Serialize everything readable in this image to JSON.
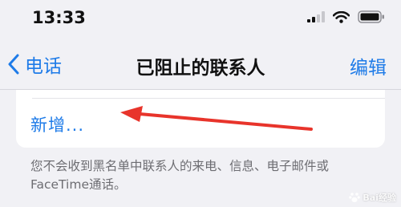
{
  "status_bar": {
    "time": "13:33",
    "icons": [
      "cellular-signal-icon",
      "wifi-icon",
      "battery-icon"
    ]
  },
  "nav": {
    "back_label": "电话",
    "title": "已阻止的联系人",
    "edit_label": "编辑"
  },
  "list": {
    "add_label": "新增..."
  },
  "footer": {
    "text": "您不会收到黑名单中联系人的来电、信息、电子邮件或FaceTime通话。"
  },
  "watermark": {
    "text": "Bai经验"
  },
  "colors": {
    "accent": "#1e7be8",
    "background": "#f1f1f5",
    "card": "#ffffff",
    "annotation_arrow": "#e8342b",
    "footer_text": "#6d6d72"
  }
}
